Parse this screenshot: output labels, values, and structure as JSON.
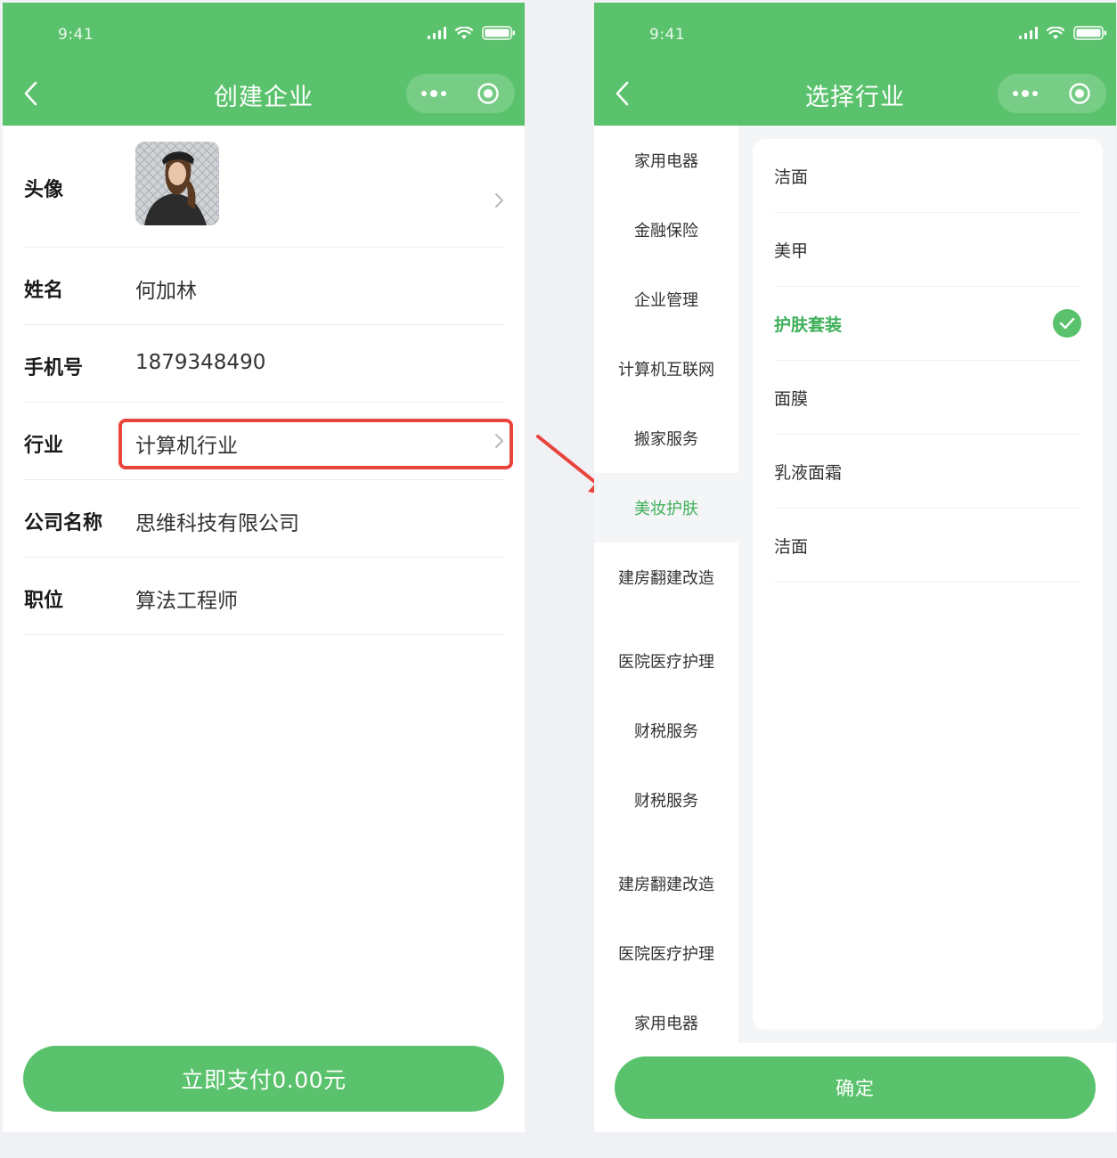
{
  "left": {
    "status": {
      "time": "9:41"
    },
    "nav": {
      "title": "创建企业"
    },
    "form": {
      "avatar_label": "头像",
      "name_label": "姓名",
      "name_value": "何加林",
      "phone_label": "手机号",
      "phone_value": "1879348490",
      "industry_label": "行业",
      "industry_value": "计算机行业",
      "company_label": "公司名称",
      "company_value": "思维科技有限公司",
      "position_label": "职位",
      "position_value": "算法工程师"
    },
    "pay_button": "立即支付0.00元"
  },
  "right": {
    "status": {
      "time": "9:41"
    },
    "nav": {
      "title": "选择行业"
    },
    "categories": [
      {
        "label": "家用电器"
      },
      {
        "label": "金融保险"
      },
      {
        "label": "企业管理"
      },
      {
        "label": "计算机互联网"
      },
      {
        "label": "搬家服务"
      },
      {
        "label": "美妆护肤",
        "active": true
      },
      {
        "label": "建房翻建改造"
      },
      {
        "label": "医院医疗护理"
      },
      {
        "label": "财税服务"
      },
      {
        "label": "财税服务"
      },
      {
        "label": "建房翻建改造"
      },
      {
        "label": "医院医疗护理"
      },
      {
        "label": "家用电器"
      }
    ],
    "subcategories": [
      {
        "label": "洁面"
      },
      {
        "label": "美甲"
      },
      {
        "label": "护肤套装",
        "selected": true
      },
      {
        "label": "面膜"
      },
      {
        "label": "乳液面霜"
      },
      {
        "label": "洁面"
      }
    ],
    "confirm_button": "确定"
  },
  "colors": {
    "brand_green": "#5ac26c",
    "active_green": "#3fb05a",
    "highlight_red": "#e8453c"
  },
  "icons": [
    "back-icon",
    "more-icon",
    "close-target-icon",
    "signal-icon",
    "wifi-icon",
    "battery-icon",
    "chevron-right-icon",
    "check-icon",
    "arrow-icon"
  ]
}
